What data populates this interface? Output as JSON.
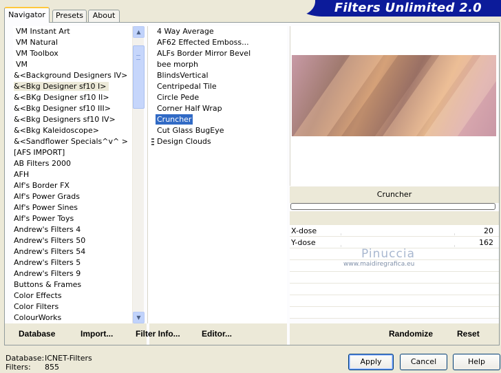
{
  "tabs": [
    {
      "label": "Navigator",
      "active": true
    },
    {
      "label": "Presets",
      "active": false
    },
    {
      "label": "About",
      "active": false
    }
  ],
  "banner": {
    "title": "Filters Unlimited 2.0"
  },
  "categories": [
    "VM Instant Art",
    "VM Natural",
    "VM Toolbox",
    "VM",
    "&<Background Designers IV>",
    "&<Bkg Designer sf10 I>",
    "&<BKg Designer sf10 II>",
    "&<Bkg Designer sf10 III>",
    "&<Bkg Designers sf10 IV>",
    "&<Bkg Kaleidoscope>",
    "&<Sandflower Specials^v^ >",
    "[AFS IMPORT]",
    "AB Filters 2000",
    "AFH",
    "Alf's Border FX",
    "Alf's Power Grads",
    "Alf's Power Sines",
    "Alf's Power Toys",
    "Andrew's Filters 4",
    "Andrew's Filters 50",
    "Andrew's Filters 54",
    "Andrew's Filters 5",
    "Andrew's Filters 9",
    "Buttons & Frames",
    "Color Effects",
    "Color Filters",
    "ColourWorks"
  ],
  "selected_category": "&<Bkg Designer sf10 I>",
  "filters": [
    "4 Way Average",
    "AF62 Effected Emboss...",
    "ALFs Border Mirror Bevel",
    "bee morph",
    "BlindsVertical",
    "Centripedal Tile",
    "Circle Pede",
    "Corner Half Wrap",
    "Cruncher",
    "Cut Glass  BugEye",
    "Design Clouds"
  ],
  "selected_filter": "Cruncher",
  "preview": {
    "filter_name": "Cruncher"
  },
  "params": [
    {
      "name": "X-dose",
      "value": "20"
    },
    {
      "name": "Y-dose",
      "value": "162"
    }
  ],
  "watermark": {
    "name": "Pinuccia",
    "url": "www.maidiregrafica.eu"
  },
  "bottom_bar": {
    "database": "Database",
    "import": "Import...",
    "filter_info": "Filter Info...",
    "editor": "Editor...",
    "randomize": "Randomize",
    "reset": "Reset"
  },
  "footer": {
    "database_label": "Database:",
    "database_value": "ICNET-Filters",
    "filters_label": "Filters:",
    "filters_value": "855"
  },
  "buttons": {
    "apply": "Apply",
    "cancel": "Cancel",
    "help": "Help"
  },
  "colors": {
    "selection": "#316ac5",
    "banner": "#0c1b9a",
    "face": "#ece9d8"
  },
  "icons": [
    "scroll-up-icon",
    "scroll-down-icon",
    "list-grip-icon"
  ]
}
